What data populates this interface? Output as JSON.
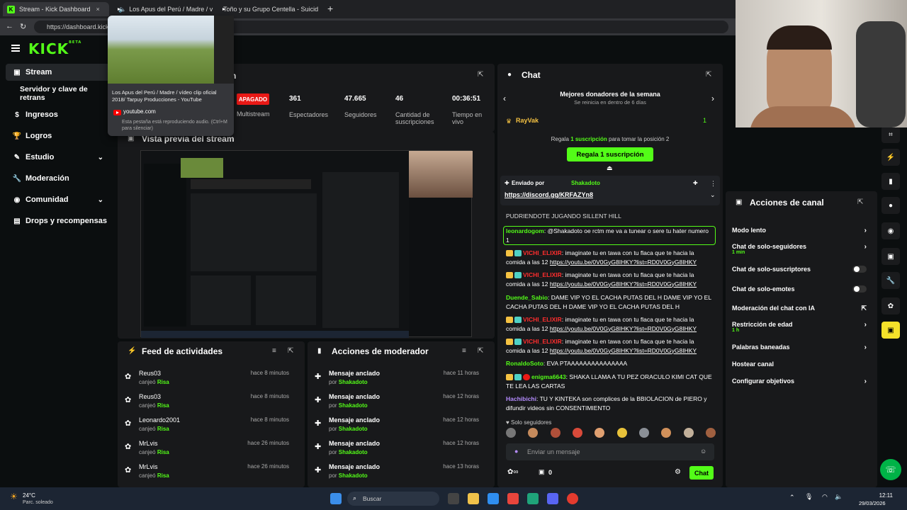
{
  "browser": {
    "tabs": [
      {
        "label": "Stream - Kick Dashboard"
      },
      {
        "label": "Los Apus del Perú / Madre / v"
      },
      {
        "label": "Toño y su Grupo Centella - Suicid"
      }
    ],
    "url": "https://dashboard.kick",
    "popup": {
      "title": "Los Apus del Perú / Madre / vídeo clip oficial 2018/ Tarpuy Producciones - YouTube",
      "site": "youtube.com",
      "note": "Esta pestaña está reproduciendo audio. (Ctrl+M para silenciar)"
    }
  },
  "sidebar": {
    "logo": "KICK",
    "beta": "BETA",
    "items": [
      {
        "label": "Stream"
      },
      {
        "label": "Servidor y clave de retrans"
      },
      {
        "label": "Ingresos"
      },
      {
        "label": "Logros"
      },
      {
        "label": "Estudio"
      },
      {
        "label": "Moderación"
      },
      {
        "label": "Comunidad"
      },
      {
        "label": "Drops y recompensas"
      }
    ]
  },
  "session": {
    "title_fragment": "n",
    "status": "APAGADO",
    "multistream": "Multistream",
    "stats": [
      {
        "value": "361",
        "label": "Espectadores"
      },
      {
        "value": "47.665",
        "label": "Seguidores"
      },
      {
        "value": "46",
        "label": "Cantidad de suscripciones"
      },
      {
        "value": "00:36:51",
        "label": "Tiempo en vivo"
      }
    ]
  },
  "preview": {
    "title": "Vista previa del stream"
  },
  "feed": {
    "title": "Feed de actividades",
    "rows": [
      {
        "name": "Reus03",
        "action": "canjeó",
        "item": "Risa",
        "time": "hace 8 minutos"
      },
      {
        "name": "Reus03",
        "action": "canjeó",
        "item": "Risa",
        "time": "hace 8 minutos"
      },
      {
        "name": "Leonardo2001",
        "action": "canjeó",
        "item": "Risa",
        "time": "hace 8 minutos"
      },
      {
        "name": "MrLvis",
        "action": "canjeó",
        "item": "Risa",
        "time": "hace 26 minutos"
      },
      {
        "name": "MrLvis",
        "action": "canjeó",
        "item": "Risa",
        "time": "hace 26 minutos"
      }
    ]
  },
  "modactions": {
    "title": "Acciones de moderador",
    "rows": [
      {
        "name": "Mensaje anclado",
        "by": "por",
        "user": "Shakadoto",
        "time": "hace 11 horas"
      },
      {
        "name": "Mensaje anclado",
        "by": "por",
        "user": "Shakadoto",
        "time": "hace 12 horas"
      },
      {
        "name": "Mensaje anclado",
        "by": "por",
        "user": "Shakadoto",
        "time": "hace 12 horas"
      },
      {
        "name": "Mensaje anclado",
        "by": "por",
        "user": "Shakadoto",
        "time": "hace 12 horas"
      },
      {
        "name": "Mensaje anclado",
        "by": "por",
        "user": "Shakadoto",
        "time": "hace 13 horas"
      }
    ]
  },
  "chat": {
    "title": "Chat",
    "donors_title": "Mejores donadores de la semana",
    "donors_sub": "Se reinicia en dentro de 6 días",
    "top_donor": "RayVak",
    "top_count": "1",
    "gift_pre": "Regala",
    "gift_mid": "1 suscripción",
    "gift_post": "para tomar la posición 2",
    "gift_button": "Regala 1 suscripción",
    "pinned_by": "Enviado por",
    "pinned_user": "Shakadoto",
    "pinned_link": "https://discord.gg/KRFAZYn8",
    "partial_line": "PUDRIENDOTE JUGANDO SILLENT HILL",
    "messages": [
      {
        "user": "leonardogom",
        "color": "#53fc18",
        "text": "@Shakadoto oe rctm me va a tunear o sere tu hater numero 1"
      },
      {
        "user": "VICHI_ELIXIR",
        "color": "#ff2d2d",
        "text": "imaginate tu en tawa con tu flaca que te hacia la comida a las 12",
        "link": "https://youtu.be/0V0GyG8IHKY?list=RD0V0GyG8IHKY"
      },
      {
        "user": "VICHI_ELIXIR",
        "color": "#ff2d2d",
        "text": "imaginate tu en tawa con tu flaca que te hacia la comida a las 12",
        "link": "https://youtu.be/0V0GyG8IHKY?list=RD0V0GyG8IHKY"
      },
      {
        "user": "Duende_Sabio",
        "color": "#53fc18",
        "text": "DAME VIP YO EL CACHA PUTAS DEL H DAME VIP YO EL CACHA PUTAS DEL H DAME VIP YO EL CACHA PUTAS DEL H"
      },
      {
        "user": "VICHI_ELIXIR",
        "color": "#ff2d2d",
        "text": "imaginate tu en tawa con tu flaca que te hacia la comida a las 12",
        "link": "https://youtu.be/0V0GyG8IHKY?list=RD0V0GyG8IHKY"
      },
      {
        "user": "VICHI_ELIXIR",
        "color": "#ff2d2d",
        "text": "imaginate tu en tawa con tu flaca que te hacia la comida a las 12",
        "link": "https://youtu.be/0V0GyG8IHKY?list=RD0V0GyG8IHKY"
      },
      {
        "user": "RonaldoSoto",
        "color": "#53fc18",
        "text": "EVA PTAAAAAAAAAAAAAAA"
      },
      {
        "user": "enigma6643",
        "color": "#53fc18",
        "text": "SHAKA LLAMA A TU PEZ ORACULO KIMI CAT QUE TE LEA LAS CARTAS"
      },
      {
        "user": "Hachibichi",
        "color": "#b58cff",
        "text": "TU Y KINTEKA son complices de la BBIOLACION de PIERO y difundir videos sin CONSENTIMIENTO"
      }
    ],
    "followers_only": "Solo seguidores",
    "input_placeholder": "Enviar un mensaje",
    "points": "0",
    "send_button": "Chat"
  },
  "actions": {
    "title": "Acciones de canal",
    "rows": [
      {
        "label": "Modo lento",
        "sub": ""
      },
      {
        "label": "Chat de solo-seguidores",
        "sub": "1 min"
      },
      {
        "label": "Chat de solo-suscriptores",
        "sub": ""
      },
      {
        "label": "Chat de solo-emotes",
        "sub": ""
      },
      {
        "label": "Moderación del chat con IA",
        "sub": ""
      },
      {
        "label": "Restricción de edad",
        "sub": "1 h"
      },
      {
        "label": "Palabras baneadas",
        "sub": ""
      },
      {
        "label": "Hostear canal",
        "sub": ""
      },
      {
        "label": "Configurar objetivos",
        "sub": ""
      }
    ]
  },
  "taskbar": {
    "temp": "24°C",
    "weather": "Parc. soleado",
    "search": "Buscar",
    "time": "12:11",
    "date": "29/03/2026"
  },
  "colors": {
    "accent": "#53fc18",
    "panel": "#18191b",
    "bg": "#0b0e0f"
  }
}
